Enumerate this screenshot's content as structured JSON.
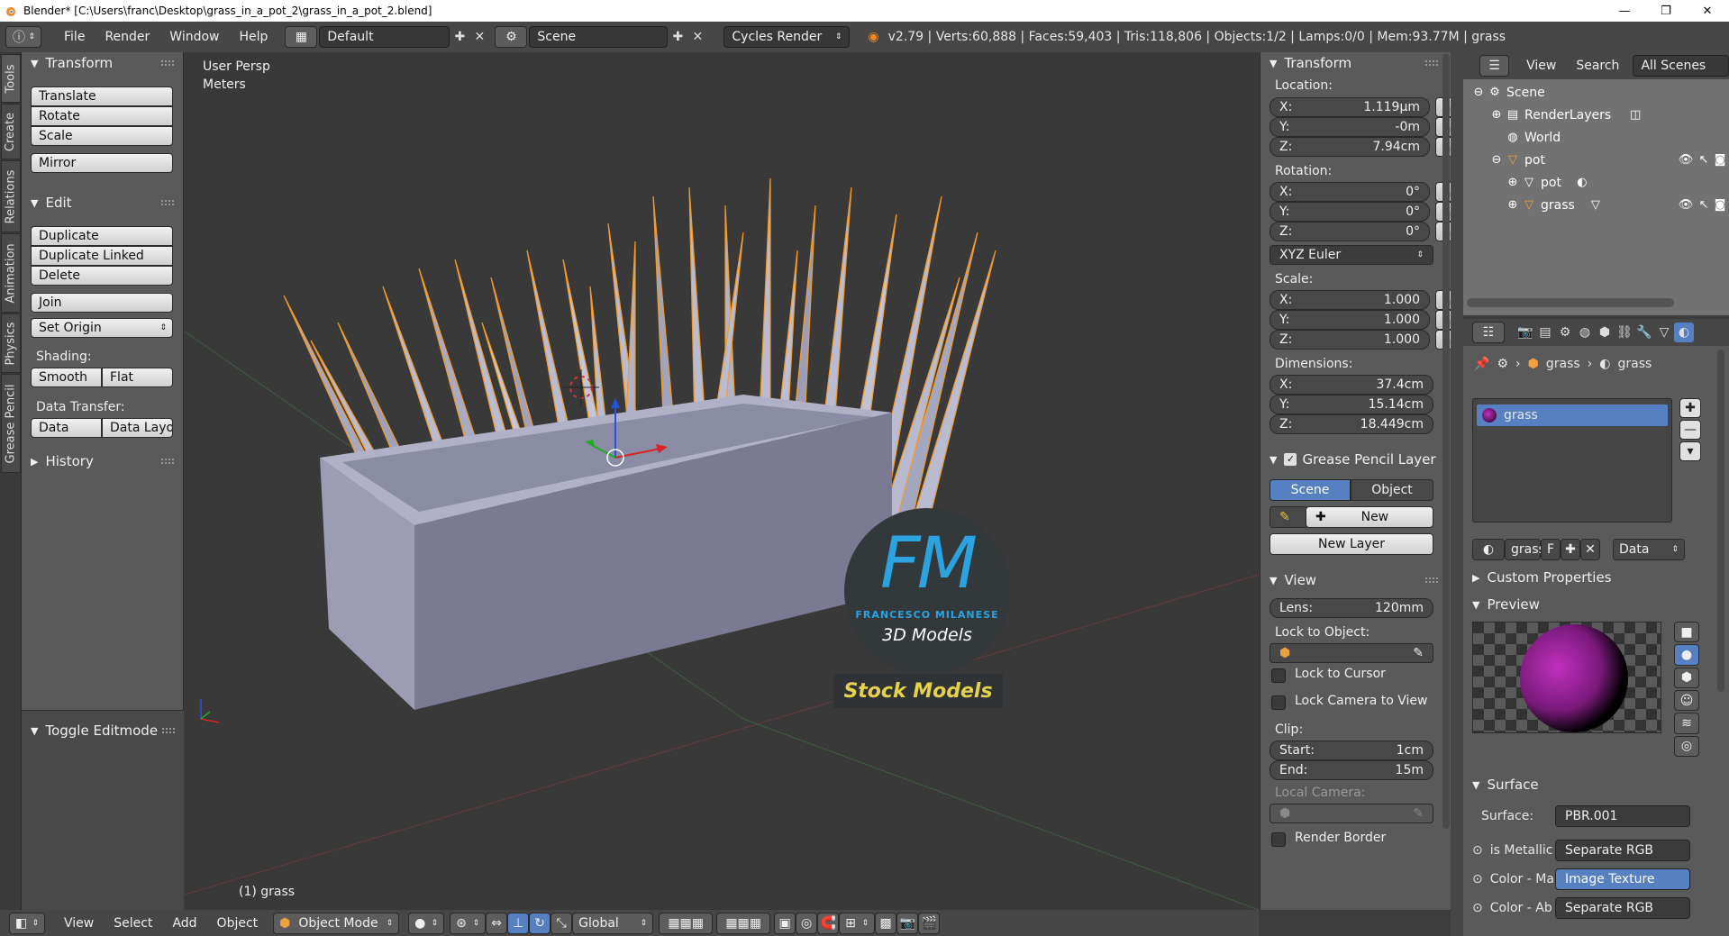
{
  "window": {
    "title": "Blender* [C:\\Users\\franc\\Desktop\\grass_in_a_pot_2\\grass_in_a_pot_2.blend]",
    "minimize": "—",
    "maximize": "❐",
    "close": "✕"
  },
  "info_header": {
    "menus": [
      "File",
      "Render",
      "Window",
      "Help"
    ],
    "layout": "Default",
    "scene": "Scene",
    "engine": "Cycles Render",
    "stats": "v2.79 | Verts:60,888 | Faces:59,403 | Tris:118,806 | Objects:1/2 | Lamps:0/0 | Mem:93.77M | grass"
  },
  "left_tabs": [
    "Tools",
    "Create",
    "Relations",
    "Animation",
    "Physics",
    "Grease Pencil"
  ],
  "toolshelf": {
    "transform_title": "Transform",
    "translate": "Translate",
    "rotate": "Rotate",
    "scale": "Scale",
    "mirror": "Mirror",
    "edit_title": "Edit",
    "duplicate": "Duplicate",
    "duplicate_linked": "Duplicate Linked",
    "delete": "Delete",
    "join": "Join",
    "set_origin": "Set Origin",
    "shading_label": "Shading:",
    "smooth": "Smooth",
    "flat": "Flat",
    "data_transfer_label": "Data Transfer:",
    "data": "Data",
    "data_layout": "Data Layo",
    "history_title": "History",
    "toggle_editmode": "Toggle Editmode"
  },
  "viewport": {
    "view_name": "User Persp",
    "units": "Meters",
    "object_label": "(1) grass",
    "logo_fm": "FM",
    "logo_author": "FRANCESCO MILANESE",
    "logo_subtitle": "3D Models",
    "logo_banner": "Stock Models"
  },
  "npanel": {
    "transform_title": "Transform",
    "location_label": "Location:",
    "loc_x": "1.119µm",
    "loc_y": "-0m",
    "loc_z": "7.94cm",
    "rotation_label": "Rotation:",
    "rot_x": "0°",
    "rot_y": "0°",
    "rot_z": "0°",
    "rotation_mode": "XYZ Euler",
    "scale_label": "Scale:",
    "scale_x": "1.000",
    "scale_y": "1.000",
    "scale_z": "1.000",
    "dimensions_label": "Dimensions:",
    "dim_x": "37.4cm",
    "dim_y": "15.14cm",
    "dim_z": "18.449cm",
    "x": "X:",
    "y": "Y:",
    "z": "Z:",
    "grease_title": "Grease Pencil Layer",
    "gp_scene": "Scene",
    "gp_object": "Object",
    "gp_new": "New",
    "gp_new_layer": "New Layer",
    "view_title": "View",
    "lens_label": "Lens:",
    "lens_value": "120mm",
    "lock_object_label": "Lock to Object:",
    "lock_cursor": "Lock to Cursor",
    "lock_camera": "Lock Camera to View",
    "clip_label": "Clip:",
    "clip_start_label": "Start:",
    "clip_start": "1cm",
    "clip_end_label": "End:",
    "clip_end": "15m",
    "local_camera": "Local Camera:",
    "render_border": "Render Border"
  },
  "outliner": {
    "view": "View",
    "search": "Search",
    "filter": "All Scenes",
    "rows": [
      "Scene",
      "RenderLayers",
      "World",
      "pot",
      "pot",
      "grass"
    ]
  },
  "properties": {
    "breadcrumb_obj": "grass",
    "breadcrumb_mat": "grass",
    "slot_name": "grass",
    "material_name": "grass",
    "fake_user": "F",
    "link_mode": "Data",
    "custom_props": "Custom Properties",
    "preview": "Preview",
    "surface_title": "Surface",
    "surface_label": "Surface:",
    "surface_value": "PBR.001",
    "metallic_label": "is Metallic",
    "metallic_value": "Separate RGB",
    "color_ma_label": "Color - Ma",
    "color_ma_value": "Image Texture",
    "color_ab_label": "Color - Ab",
    "color_ab_value": "Separate RGB"
  },
  "bottom_bar": {
    "menus": [
      "View",
      "Select",
      "Add",
      "Object"
    ],
    "mode": "Object Mode",
    "orientation": "Global"
  },
  "colors": {
    "accent_blue": "#5680c2",
    "selection_orange": "#f39a2a",
    "logo_blue": "#2ba3e0",
    "banner_yellow": "#e6d24a"
  }
}
